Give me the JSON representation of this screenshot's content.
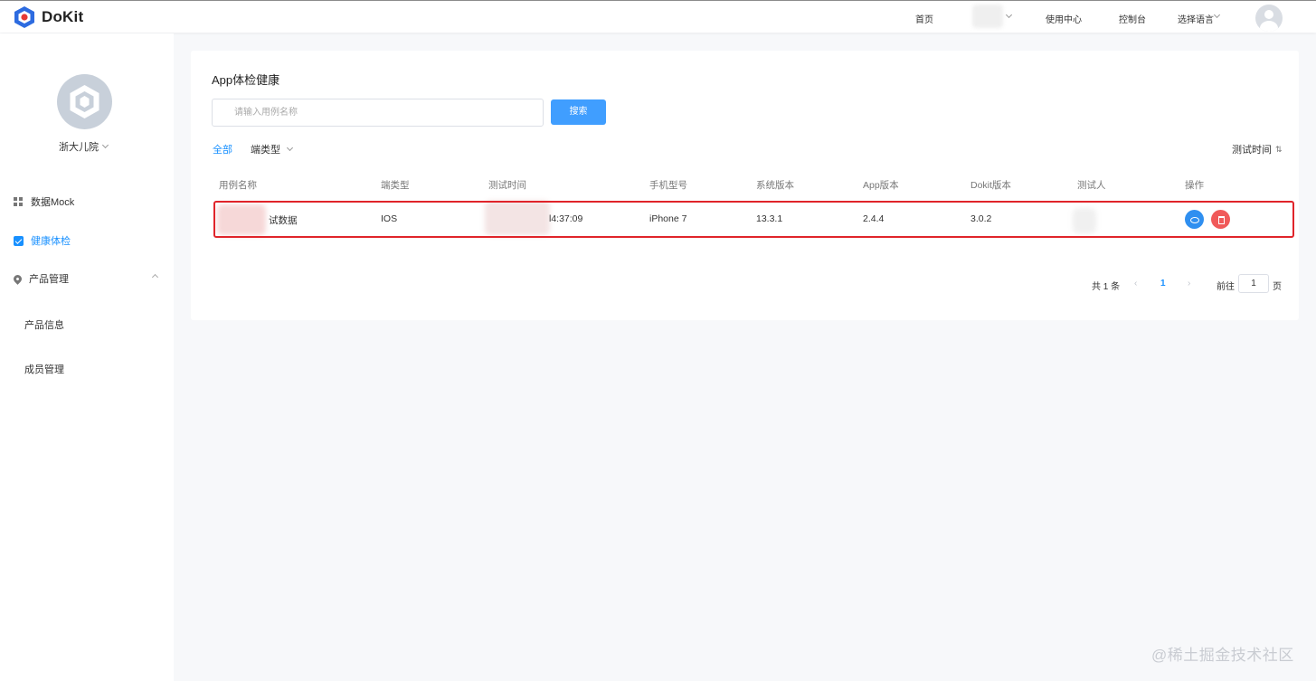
{
  "header": {
    "brand": "DoKit",
    "nav": {
      "home": "首页",
      "user_center": "使用中心",
      "console": "控制台",
      "language": "选择语言"
    }
  },
  "sidebar": {
    "org_name": "浙大儿院",
    "items": [
      {
        "label": "数据Mock",
        "icon": "grid-icon"
      },
      {
        "label": "健康体检",
        "icon": "checkbox-icon",
        "active": true
      },
      {
        "label": "产品管理",
        "icon": "location-pin-icon",
        "expanded": true
      }
    ],
    "subitems": [
      "产品信息",
      "成员管理"
    ]
  },
  "main": {
    "title": "App体检健康",
    "search": {
      "placeholder": "请输入用例名称",
      "button": "搜索"
    },
    "filters": {
      "all": "全部",
      "type": "端类型",
      "sort": "测试时间"
    },
    "table": {
      "headers": [
        "用例名称",
        "端类型",
        "测试时间",
        "手机型号",
        "系统版本",
        "App版本",
        "Dokit版本",
        "测试人",
        "操作"
      ],
      "rows": [
        {
          "name": "试数据",
          "platform": "IOS",
          "time": "l4:37:09",
          "device": "iPhone 7",
          "os": "13.3.1",
          "app_version": "2.4.4",
          "dokit_version": "3.0.2",
          "tester": ""
        }
      ]
    },
    "pagination": {
      "total": "共 1 条",
      "current": "1",
      "goto_label": "前往",
      "goto_value": "1",
      "page_suffix": "页"
    }
  },
  "watermark": "@稀土掘金技术社区",
  "colors": {
    "primary": "#409eff",
    "active": "#1890ff",
    "danger": "#f05a5a",
    "highlight": "#e0242a"
  }
}
